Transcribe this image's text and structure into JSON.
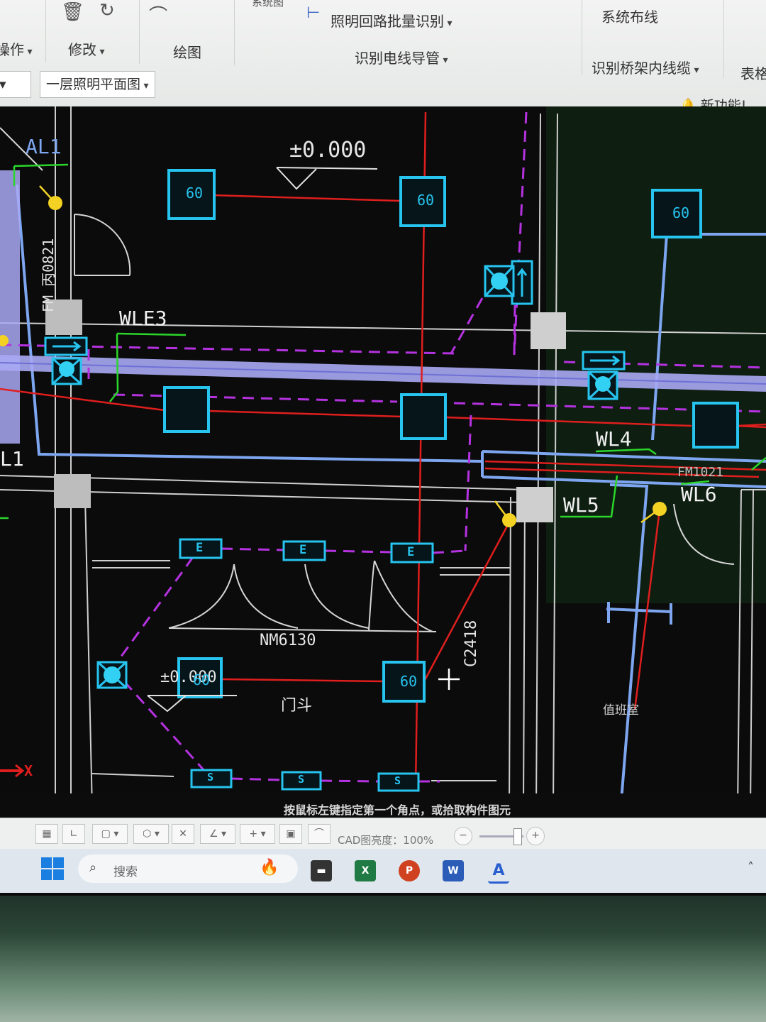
{
  "ribbon": {
    "cut_label": "系统图",
    "lighting_circuit_batch": "照明回路批量识别",
    "system_wiring": "系统布线",
    "operate_group": "操作",
    "modify_group": "修改",
    "draw_group": "绘图",
    "identify_wire_conduit": "识别电线导管",
    "identify_tray_cable": "识别桥架内线缆",
    "table_label": "表格",
    "new_feature": "新功能!",
    "floor_select": "一层照明平面图"
  },
  "drawing": {
    "level_top": "±0.000",
    "level_bottom": "±0.000",
    "door_code": "NM6130",
    "door_text": "门斗",
    "window_code": "C2418",
    "side_text": "值班室",
    "vertical_text": "FM 丙0821",
    "circuit_wle3": "WLE3",
    "circuit_wl4": "WL4",
    "circuit_wl5": "WL5",
    "circuit_wl6": "WL6",
    "circuit_al1": "AL1",
    "circuit_l1": "L1",
    "fm_right": "FM1021",
    "fixture_60": "60",
    "fixture_e": "E",
    "fixture_s": "S",
    "axis_x": "X"
  },
  "command_line": "按鼠标左键指定第一个角点，或拾取构件图元",
  "statusbar": {
    "cad_brightness_label": "CAD图亮度：",
    "cad_brightness_value": "100%"
  },
  "taskbar": {
    "search_placeholder": "搜索"
  },
  "colors": {
    "cyan": "#27c4ef",
    "red": "#e01e1e",
    "magenta": "#b532e0",
    "green": "#2bd62b",
    "lavender": "#a9a8f4",
    "blue": "#7ea6f0"
  }
}
